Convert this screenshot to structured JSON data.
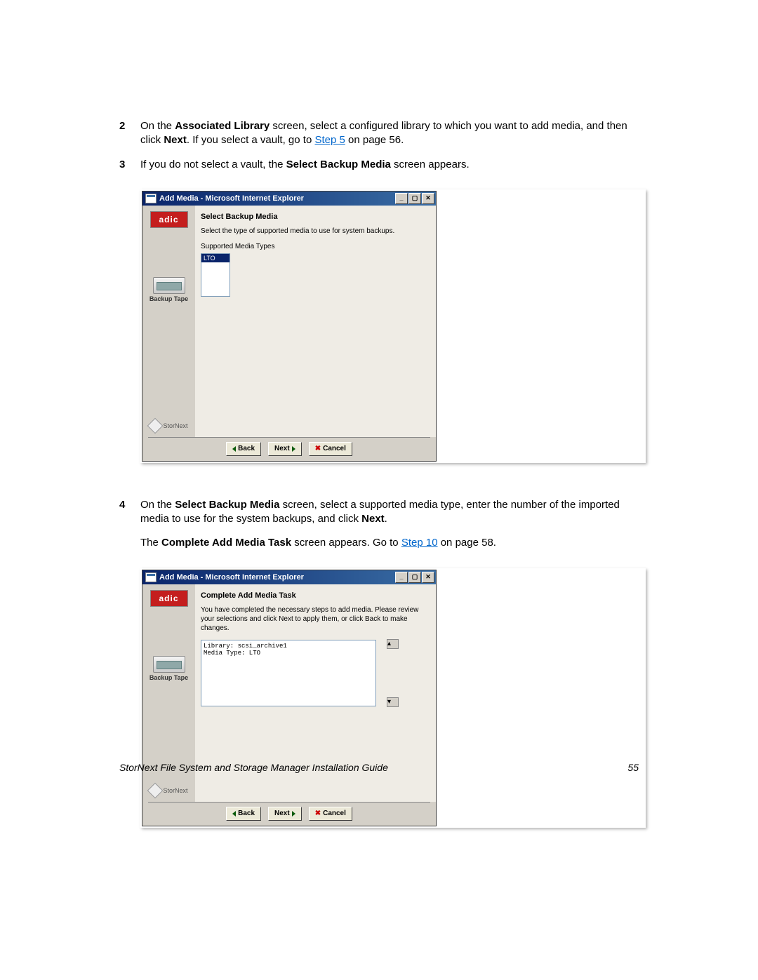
{
  "steps": {
    "s2": {
      "num": "2",
      "pre": "On the ",
      "bold1": "Associated Library",
      "mid1": " screen, select a configured library to which you want to add media, and then click ",
      "bold2": "Next",
      "mid2": ". If you select a vault, go to ",
      "link": "Step 5",
      "post": " on page 56."
    },
    "s3": {
      "num": "3",
      "pre": "If you do not select a vault, the ",
      "bold1": "Select Backup Media",
      "post": " screen appears."
    },
    "s4": {
      "num": "4",
      "pre": "On the ",
      "bold1": "Select Backup Media",
      "mid1": " screen, select a supported media type, enter the number of the imported media to use for the system backups, and click ",
      "bold2": "Next",
      "post": "."
    }
  },
  "para1": {
    "pre": "The ",
    "bold1": "Complete Add Media Task",
    "mid1": " screen appears. Go to ",
    "link": "Step 10",
    "post": " on page 58."
  },
  "dialog1": {
    "title": "Add Media - Microsoft Internet Explorer",
    "logo": "adic",
    "sidebar_label": "Backup Tape",
    "stornext": "StorNext",
    "heading": "Select Backup Media",
    "instruction": "Select the type of supported media to use for system backups.",
    "list_label": "Supported Media Types",
    "list_item": "LTO",
    "back": "Back",
    "next": "Next",
    "cancel": "Cancel"
  },
  "dialog2": {
    "title": "Add Media - Microsoft Internet Explorer",
    "logo": "adic",
    "sidebar_label": "Backup Tape",
    "stornext": "StorNext",
    "heading": "Complete Add Media Task",
    "instruction": "You have completed the necessary steps to add media. Please review your selections and click Next to apply them, or click Back to make changes.",
    "summary_l1": "Library: scsi_archive1",
    "summary_l2": "Media Type: LTO",
    "back": "Back",
    "next": "Next",
    "cancel": "Cancel"
  },
  "footer": {
    "title": "StorNext File System and Storage Manager Installation Guide",
    "page": "55"
  }
}
